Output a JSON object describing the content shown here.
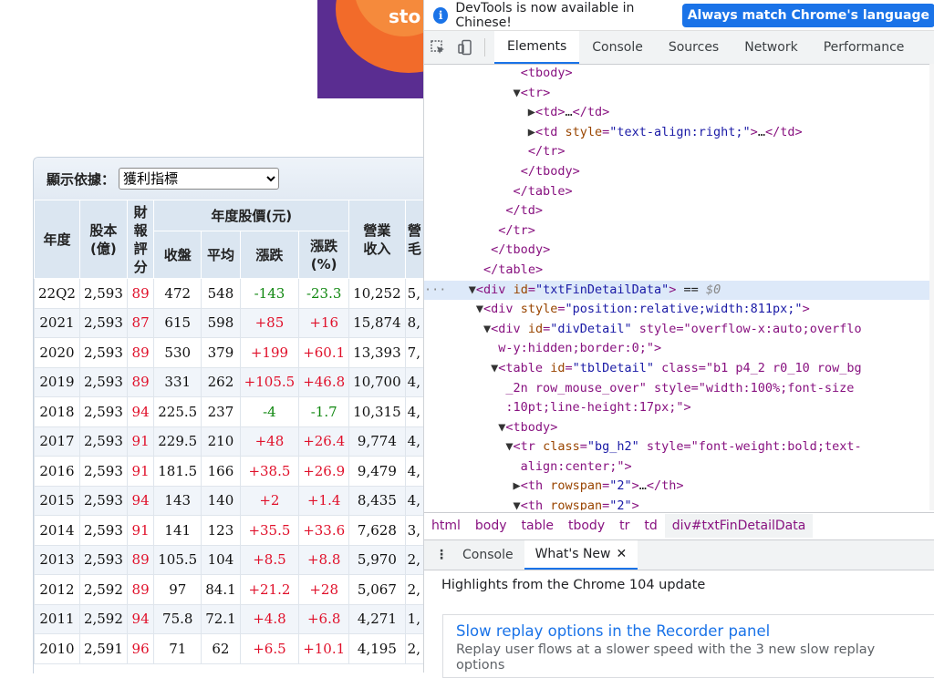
{
  "banner": {
    "text": "sto"
  },
  "filter": {
    "label": "顯示依據：",
    "selected": "獲利指標"
  },
  "table": {
    "headers": {
      "year": "年度",
      "capital": "股本\n(億)",
      "rating": "財報\n評分",
      "price_group": "年度股價(元)",
      "close": "收盤",
      "avg": "平均",
      "change": "漲跌",
      "change_pct": "漲跌\n(%)",
      "revenue": "營業\n收入",
      "gross_partial": "營\n毛"
    },
    "rows": [
      {
        "year": "22Q2",
        "capital": "2,593",
        "rating": "89",
        "close": "472",
        "avg": "548",
        "change": "-143",
        "pct": "-23.3",
        "rev": "10,252",
        "next": "5,"
      },
      {
        "year": "2021",
        "capital": "2,593",
        "rating": "87",
        "close": "615",
        "avg": "598",
        "change": "+85",
        "pct": "+16",
        "rev": "15,874",
        "next": "8,"
      },
      {
        "year": "2020",
        "capital": "2,593",
        "rating": "89",
        "close": "530",
        "avg": "379",
        "change": "+199",
        "pct": "+60.1",
        "rev": "13,393",
        "next": "7,"
      },
      {
        "year": "2019",
        "capital": "2,593",
        "rating": "89",
        "close": "331",
        "avg": "262",
        "change": "+105.5",
        "pct": "+46.8",
        "rev": "10,700",
        "next": "4,"
      },
      {
        "year": "2018",
        "capital": "2,593",
        "rating": "94",
        "close": "225.5",
        "avg": "237",
        "change": "-4",
        "pct": "-1.7",
        "rev": "10,315",
        "next": "4,"
      },
      {
        "year": "2017",
        "capital": "2,593",
        "rating": "91",
        "close": "229.5",
        "avg": "210",
        "change": "+48",
        "pct": "+26.4",
        "rev": "9,774",
        "next": "4,"
      },
      {
        "year": "2016",
        "capital": "2,593",
        "rating": "91",
        "close": "181.5",
        "avg": "166",
        "change": "+38.5",
        "pct": "+26.9",
        "rev": "9,479",
        "next": "4,"
      },
      {
        "year": "2015",
        "capital": "2,593",
        "rating": "94",
        "close": "143",
        "avg": "140",
        "change": "+2",
        "pct": "+1.4",
        "rev": "8,435",
        "next": "4,"
      },
      {
        "year": "2014",
        "capital": "2,593",
        "rating": "91",
        "close": "141",
        "avg": "123",
        "change": "+35.5",
        "pct": "+33.6",
        "rev": "7,628",
        "next": "3,"
      },
      {
        "year": "2013",
        "capital": "2,593",
        "rating": "89",
        "close": "105.5",
        "avg": "104",
        "change": "+8.5",
        "pct": "+8.8",
        "rev": "5,970",
        "next": "2,"
      },
      {
        "year": "2012",
        "capital": "2,592",
        "rating": "89",
        "close": "97",
        "avg": "84.1",
        "change": "+21.2",
        "pct": "+28",
        "rev": "5,067",
        "next": "2,"
      },
      {
        "year": "2011",
        "capital": "2,592",
        "rating": "94",
        "close": "75.8",
        "avg": "72.1",
        "change": "+4.8",
        "pct": "+6.8",
        "rev": "4,271",
        "next": "1,"
      },
      {
        "year": "2010",
        "capital": "2,591",
        "rating": "96",
        "close": "71",
        "avg": "62",
        "change": "+6.5",
        "pct": "+10.1",
        "rev": "4,195",
        "next": "2,"
      }
    ]
  },
  "devtools": {
    "infobar": {
      "message": "DevTools is now available in Chinese!",
      "button": "Always match Chrome's language"
    },
    "tabs": [
      "Elements",
      "Console",
      "Sources",
      "Network",
      "Performance"
    ],
    "active_tab": "Elements",
    "breadcrumbs": [
      "html",
      "body",
      "table",
      "tbody",
      "tr",
      "td",
      "div#txtFinDetailData"
    ],
    "drawer_tabs": [
      "Console",
      "What's New"
    ],
    "highlights": "Highlights from the Chrome 104 update",
    "card": {
      "title": "Slow replay options in the Recorder panel",
      "desc": "Replay user flows at a slower speed with the 3 new slow replay options"
    },
    "dom_lines": [
      "<tbody>",
      "<tr>",
      "<td>…</td>",
      "<td style=\"text-align:right;\">…</td>",
      "</tr>",
      "</tbody>",
      "</table>",
      "</td>",
      "</tr>",
      "</tbody>",
      "</table>",
      "<div id=\"txtFinDetailData\"> == $0",
      "<div style=\"position:relative;width:811px;\">",
      "<div id=\"divDetail\" style=\"overflow-x:auto;overflow-y:hidden;border:0;\">",
      "<table id=\"tblDetail\" class=\"b1 p4_2 r0_10 row_bg_2n row_mouse_over\" style=\"width:100%;font-size:10pt;line-height:17px;\">",
      "<tbody>",
      "<tr class=\"bg_h2\" style=\"font-weight:bold;text-align:center;\">",
      "<th rowspan=\"2\">…</th>",
      "<th rowspan=\"2\">"
    ]
  }
}
